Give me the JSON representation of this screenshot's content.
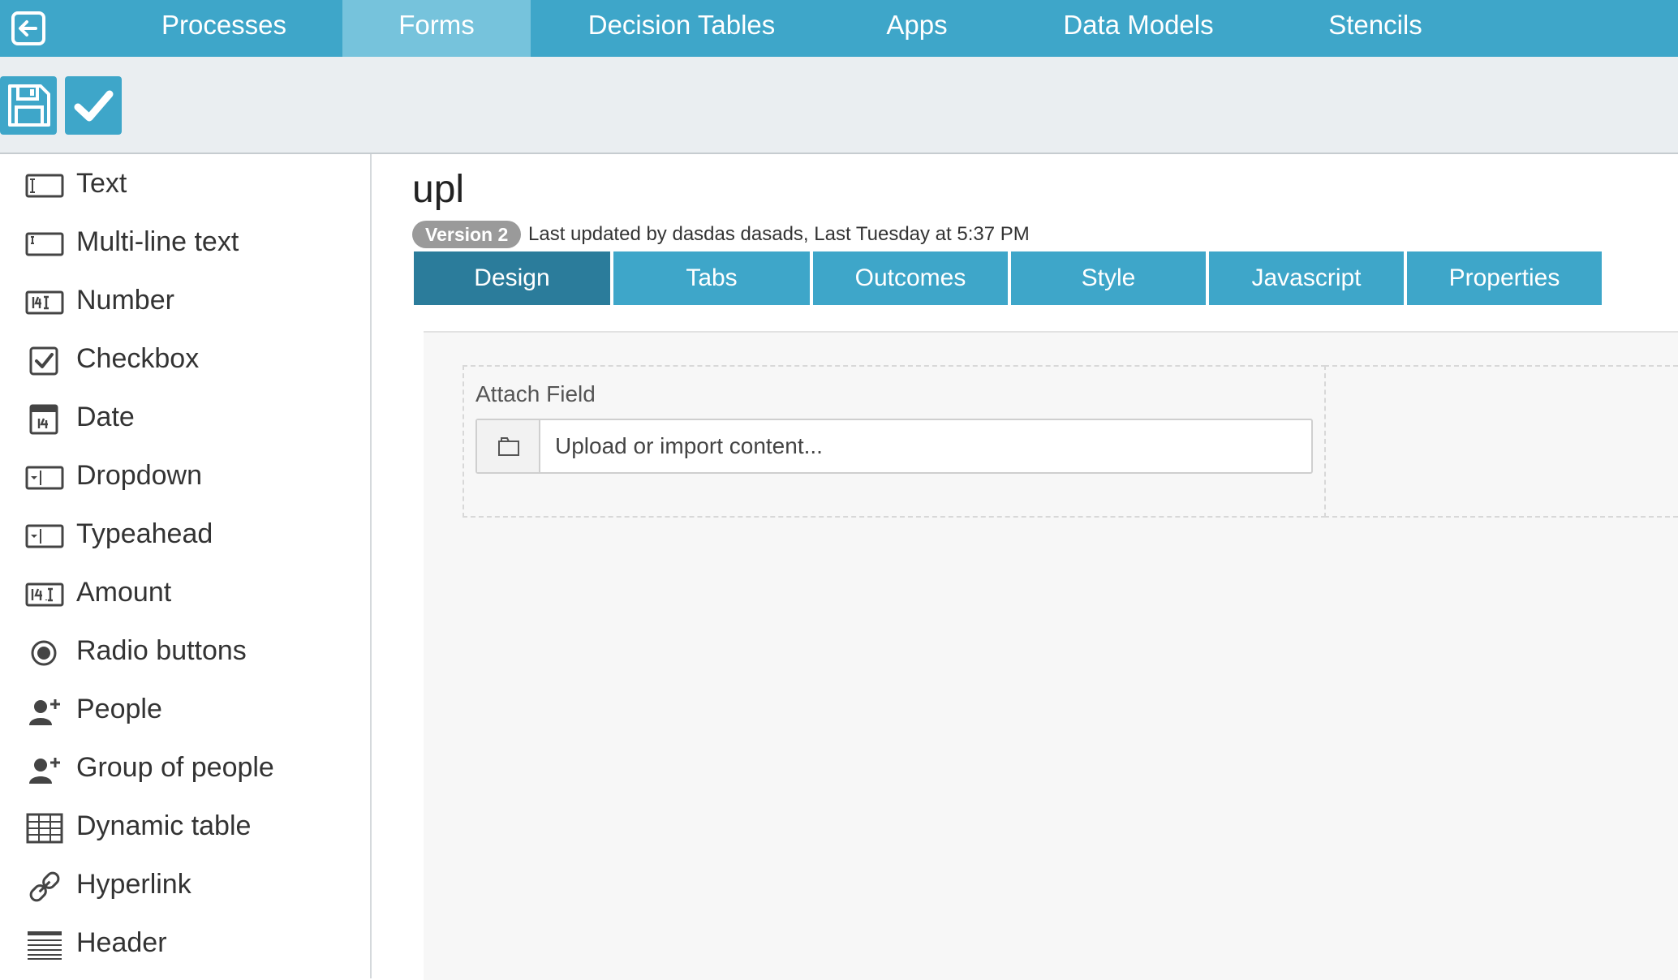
{
  "nav": {
    "items": [
      {
        "label": "Processes"
      },
      {
        "label": "Forms"
      },
      {
        "label": "Decision Tables"
      },
      {
        "label": "Apps"
      },
      {
        "label": "Data Models"
      },
      {
        "label": "Stencils"
      }
    ],
    "active": "Forms",
    "logo_icon": "exit-arrow-icon"
  },
  "toolbar": {
    "save_icon": "floppy-disk-icon",
    "validate_icon": "checkmark-icon"
  },
  "palette": {
    "items": [
      {
        "label": "Text",
        "icon": "text-field-icon"
      },
      {
        "label": "Multi-line text",
        "icon": "multiline-text-icon"
      },
      {
        "label": "Number",
        "icon": "number-field-icon"
      },
      {
        "label": "Checkbox",
        "icon": "checkbox-icon"
      },
      {
        "label": "Date",
        "icon": "calendar-icon"
      },
      {
        "label": "Dropdown",
        "icon": "dropdown-icon"
      },
      {
        "label": "Typeahead",
        "icon": "typeahead-icon"
      },
      {
        "label": "Amount",
        "icon": "amount-icon"
      },
      {
        "label": "Radio buttons",
        "icon": "radio-icon"
      },
      {
        "label": "People",
        "icon": "add-person-icon"
      },
      {
        "label": "Group of people",
        "icon": "add-group-icon"
      },
      {
        "label": "Dynamic table",
        "icon": "table-icon"
      },
      {
        "label": "Hyperlink",
        "icon": "link-icon"
      },
      {
        "label": "Header",
        "icon": "header-icon"
      }
    ]
  },
  "form": {
    "title": "upl",
    "version": "Version 2",
    "last_updated": "Last updated by dasdas dasads, Last Tuesday at 5:37 PM"
  },
  "tabs": {
    "items": [
      {
        "label": "Design"
      },
      {
        "label": "Tabs"
      },
      {
        "label": "Outcomes"
      },
      {
        "label": "Style"
      },
      {
        "label": "Javascript"
      },
      {
        "label": "Properties"
      }
    ],
    "active": "Design"
  },
  "canvas": {
    "field_label": "Attach Field",
    "upload_placeholder": "Upload or import content...",
    "upload_icon": "folder-icon"
  },
  "colors": {
    "primary": "#3ea6c9",
    "nav_active": "#76c3dc",
    "tab_active": "#2b7c9b",
    "badge": "#9a9a9a"
  }
}
